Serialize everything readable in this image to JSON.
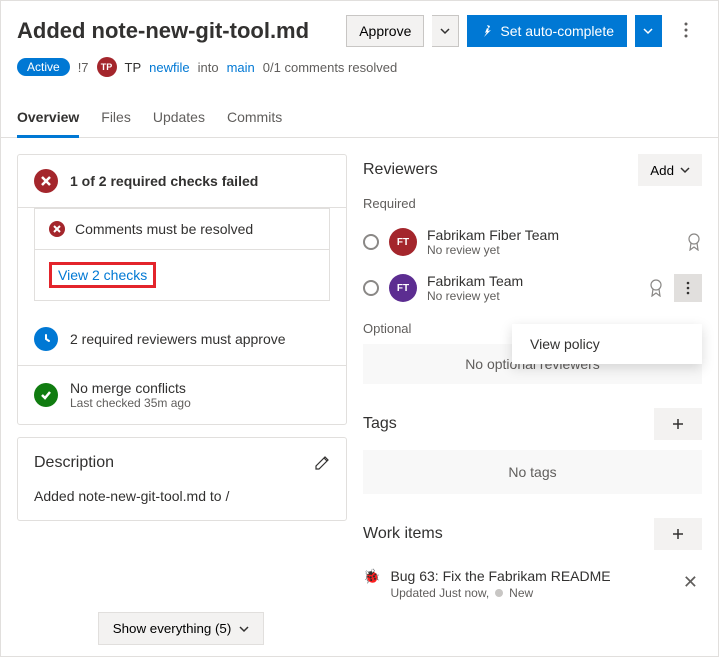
{
  "header": {
    "title": "Added note-new-git-tool.md",
    "approve_label": "Approve",
    "autocomplete_label": "Set auto-complete",
    "status_badge": "Active",
    "pr_id": "!7",
    "author_initials": "TP",
    "author_name": "TP",
    "source_branch": "newfile",
    "into_text": "into",
    "target_branch": "main",
    "comments_resolved": "0/1 comments resolved"
  },
  "tabs": [
    "Overview",
    "Files",
    "Updates",
    "Commits"
  ],
  "checks": {
    "summary": "1 of 2 required checks failed",
    "items": [
      {
        "text": "Comments must be resolved"
      }
    ],
    "view_link": "View 2 checks"
  },
  "reviewers_pending": "2 required reviewers must approve",
  "merge": {
    "title": "No merge conflicts",
    "sub": "Last checked 35m ago"
  },
  "description": {
    "heading": "Description",
    "text": "Added note-new-git-tool.md to /"
  },
  "reviewers": {
    "heading": "Reviewers",
    "add_label": "Add",
    "required_label": "Required",
    "optional_label": "Optional",
    "optional_empty": "No optional reviewers",
    "list": [
      {
        "initials": "FT",
        "name": "Fabrikam Fiber Team",
        "sub": "No review yet",
        "color": "#a4262c"
      },
      {
        "initials": "FT",
        "name": "Fabrikam Team",
        "sub": "No review yet",
        "color": "#5c2d91"
      }
    ]
  },
  "popup": {
    "view_policy": "View policy"
  },
  "tags": {
    "heading": "Tags",
    "empty": "No tags"
  },
  "work_items": {
    "heading": "Work items",
    "items": [
      {
        "title": "Bug 63: Fix the Fabrikam README",
        "updated": "Updated Just now,",
        "state": "New"
      }
    ]
  },
  "footer": {
    "show_label": "Show everything (5)"
  }
}
